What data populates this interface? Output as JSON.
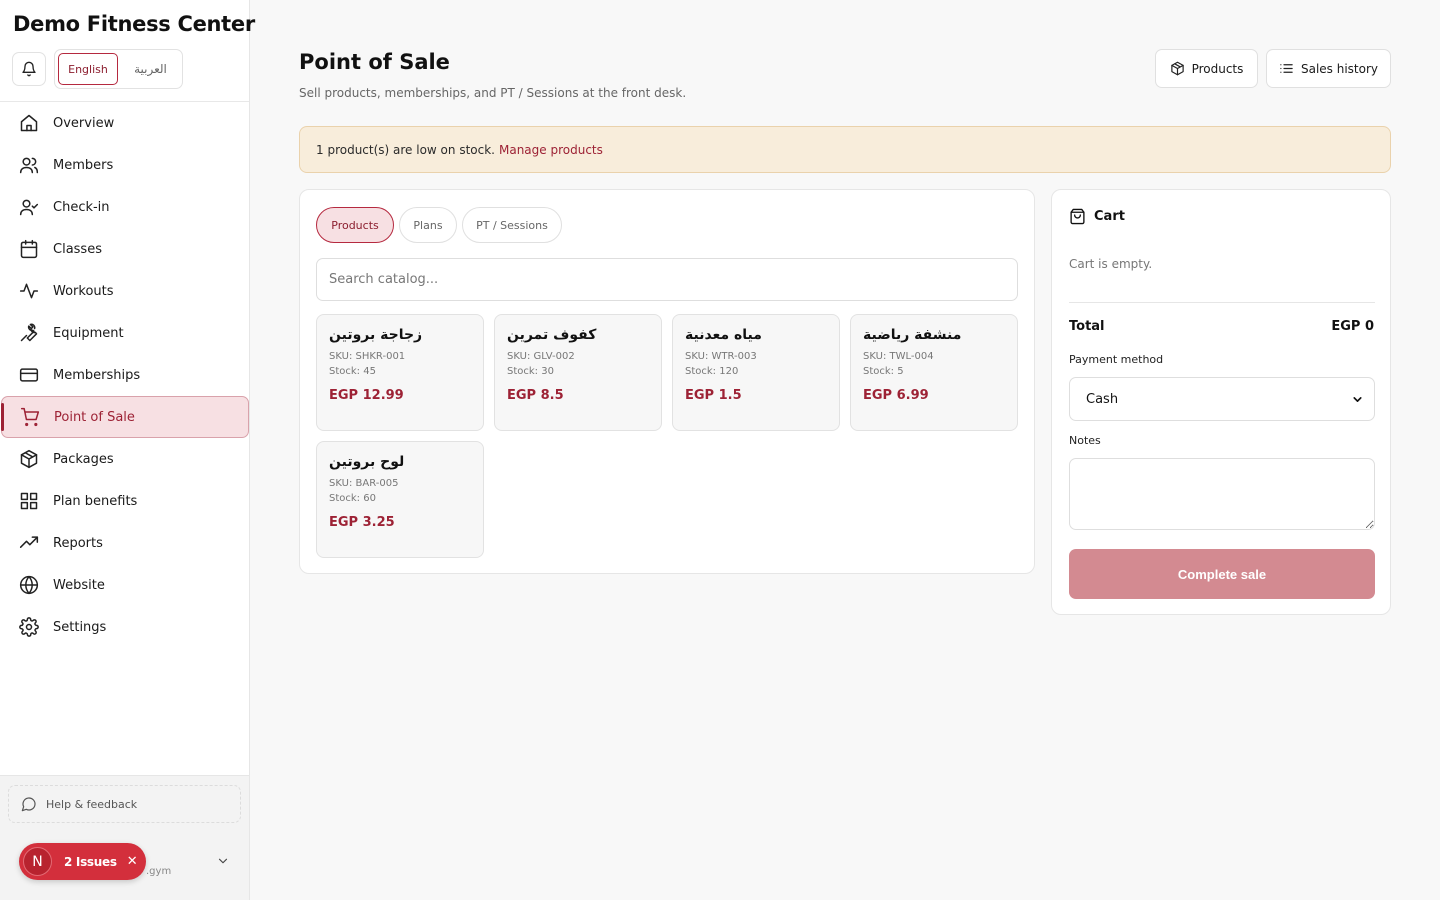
{
  "sidebar": {
    "brand": "Demo Fitness Center",
    "lang": {
      "english": "English",
      "arabic": "العربية"
    },
    "items": [
      {
        "label": "Overview",
        "icon": "home-icon"
      },
      {
        "label": "Members",
        "icon": "users-icon"
      },
      {
        "label": "Check-in",
        "icon": "user-check-icon"
      },
      {
        "label": "Classes",
        "icon": "calendar-icon"
      },
      {
        "label": "Workouts",
        "icon": "activity-icon"
      },
      {
        "label": "Equipment",
        "icon": "wrench-icon"
      },
      {
        "label": "Memberships",
        "icon": "credit-card-icon"
      },
      {
        "label": "Point of Sale",
        "icon": "cart-icon",
        "active": true
      },
      {
        "label": "Packages",
        "icon": "package-icon"
      },
      {
        "label": "Plan benefits",
        "icon": "grid-icon"
      },
      {
        "label": "Reports",
        "icon": "trending-up-icon"
      },
      {
        "label": "Website",
        "icon": "globe-icon"
      },
      {
        "label": "Settings",
        "icon": "gear-icon"
      }
    ],
    "help": "Help & feedback",
    "user_domain": ".gym"
  },
  "issues": {
    "letter": "N",
    "label": "2 Issues"
  },
  "header": {
    "title": "Point of Sale",
    "subtitle": "Sell products, memberships, and PT / Sessions at the front desk.",
    "products_btn": "Products",
    "history_btn": "Sales history"
  },
  "alert": {
    "text": "1 product(s) are low on stock.",
    "link": "Manage products"
  },
  "catalog": {
    "tabs": [
      "Products",
      "Plans",
      "PT / Sessions"
    ],
    "active_tab": "Products",
    "search_placeholder": "Search catalog...",
    "products": [
      {
        "name": "زجاجة بروتين",
        "sku": "SKU: SHKR-001",
        "stock": "Stock: 45",
        "price": "EGP 12.99"
      },
      {
        "name": "كفوف تمرين",
        "sku": "SKU: GLV-002",
        "stock": "Stock: 30",
        "price": "EGP 8.5"
      },
      {
        "name": "مياه معدنية",
        "sku": "SKU: WTR-003",
        "stock": "Stock: 120",
        "price": "EGP 1.5"
      },
      {
        "name": "منشفة رياضية",
        "sku": "SKU: TWL-004",
        "stock": "Stock: 5",
        "price": "EGP 6.99"
      },
      {
        "name": "لوح بروتين",
        "sku": "SKU: BAR-005",
        "stock": "Stock: 60",
        "price": "EGP 3.25"
      }
    ]
  },
  "cart": {
    "title": "Cart",
    "empty": "Cart is empty.",
    "total_label": "Total",
    "total_value": "EGP 0",
    "payment_label": "Payment method",
    "payment_value": "Cash",
    "notes_label": "Notes",
    "notes_value": "",
    "complete": "Complete sale"
  },
  "colors": {
    "accent": "#9d2235",
    "accent_light": "#f7e0e3",
    "disabled_button": "#d38a91",
    "alert_bg": "#f8eddb",
    "issues_badge": "#d32f3c"
  }
}
